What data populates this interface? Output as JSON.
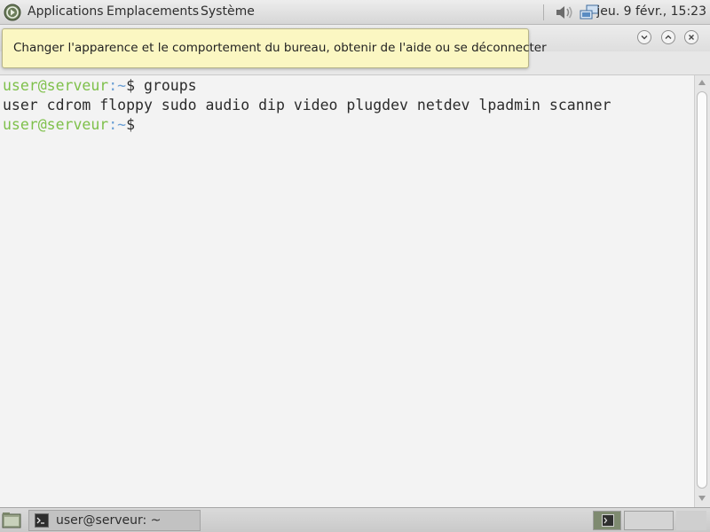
{
  "top_panel": {
    "menu": {
      "applications": "Applications",
      "places": "Emplacements",
      "system": "Système"
    },
    "tray": {
      "volume_icon": "speaker-volume-icon",
      "network_icon": "network-wired-icon"
    },
    "clock": "jeu.  9 févr., 15:23"
  },
  "tooltip": {
    "text": "Changer l'apparence et le comportement du bureau, obtenir de l'aide ou se déconnecter"
  },
  "terminal": {
    "line1": {
      "user": "user@serveur",
      "path": ":~",
      "rest": "$ groups"
    },
    "line2": "user cdrom floppy sudo audio dip video plugdev netdev lpadmin scanner",
    "line3": {
      "user": "user@serveur",
      "path": ":~",
      "rest": "$"
    }
  },
  "taskbar": {
    "window_button": "user@serveur: ~",
    "workspace_count": 2
  },
  "colors": {
    "prompt_user": "#7ec04a",
    "prompt_path": "#6a9fd4",
    "tooltip_bg": "#fbf7c2"
  }
}
